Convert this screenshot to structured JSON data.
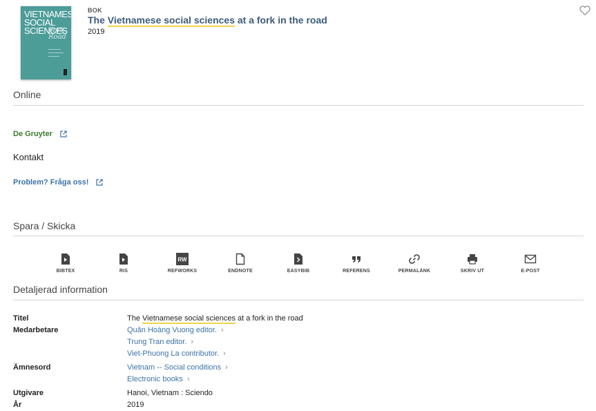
{
  "record": {
    "cover_line1": "VIETNAMESE",
    "cover_line2": "SOCIAL",
    "cover_line3": "SCIENCES",
    "cover_italic1": "Fork",
    "cover_italic2": "Road",
    "type": "BOK",
    "title_pre": "The ",
    "title_hl": "Vietnamese social sciences",
    "title_post": " at a fork in the road",
    "year": "2019",
    "favorite_icon": "heart-icon"
  },
  "online": {
    "title": "Online",
    "provider": "De Gruyter",
    "contact_label": "Kontakt",
    "problem_link": "Problem? Fråga oss!"
  },
  "save": {
    "title": "Spara / Skicka",
    "actions": [
      {
        "label": "BIBTEX",
        "icon": "bibtex-icon"
      },
      {
        "label": "RIS",
        "icon": "ris-icon"
      },
      {
        "label": "REFWORKS",
        "icon": "refworks-icon"
      },
      {
        "label": "ENDNOTE",
        "icon": "endnote-icon"
      },
      {
        "label": "EASYBIB",
        "icon": "easybib-icon"
      },
      {
        "label": "REFERENS",
        "icon": "quote-icon"
      },
      {
        "label": "PERMALÄNK",
        "icon": "link-icon"
      },
      {
        "label": "SKRIV UT",
        "icon": "print-icon"
      },
      {
        "label": "E-POST",
        "icon": "mail-icon"
      }
    ],
    "refworks_badge": "RW"
  },
  "details": {
    "title": "Detaljerad information",
    "labels": {
      "title": "Titel",
      "contributors": "Medarbetare",
      "subjects": "Ämnesord",
      "publisher": "Utgivare",
      "year": "År"
    },
    "title_pre": "The ",
    "title_hl": "Vietnamese social sciences",
    "title_post": " at a fork in the road",
    "contributors": [
      "Quân Hoàng Vuong editor.",
      "Trung Tran editor.",
      "Viet-Phuong La contributor."
    ],
    "subjects": [
      "Vietnam -- Social conditions",
      "Electronic books"
    ],
    "publisher": "Hanoi, Vietnam : Sciendo",
    "year": "2019"
  },
  "colors": {
    "link": "#3b73a8",
    "provider": "#3a7a2a",
    "highlight": "#f0d34a",
    "cover": "#4c9c98"
  }
}
